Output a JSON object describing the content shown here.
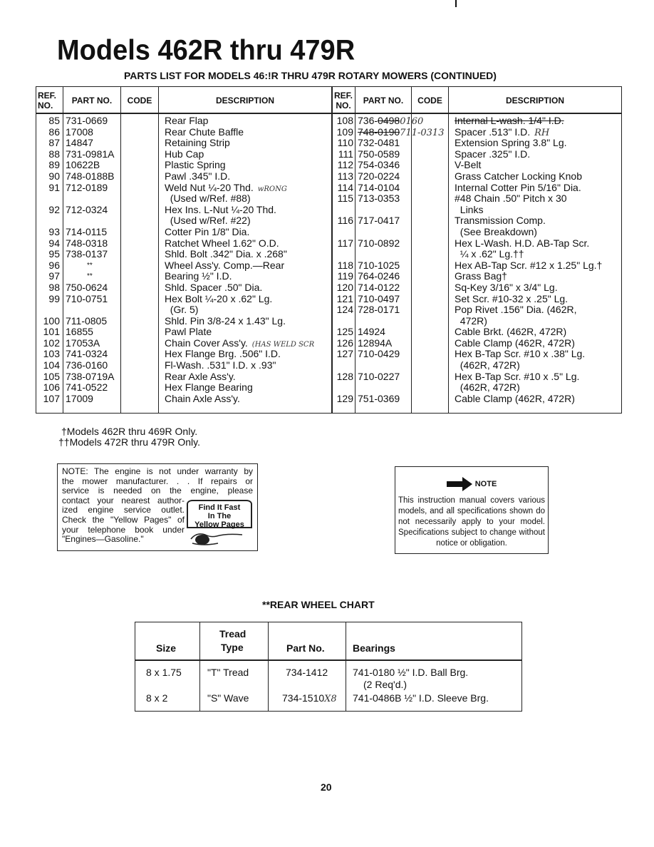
{
  "page": {
    "title": "Models 462R thru 479R",
    "subtitle": "PARTS LIST FOR MODELS 46:!R THRU 479R ROTARY MOWERS (CONTINUED)",
    "page_number": "20"
  },
  "parts_table": {
    "headers": {
      "ref": "REF. NO.",
      "part": "PART NO.",
      "code": "CODE",
      "description": "DESCRIPTION"
    },
    "left_rows": [
      {
        "ref": "85",
        "part": "731-0669",
        "desc": "Rear Flap"
      },
      {
        "ref": "86",
        "part": "17008",
        "desc": "Rear Chute Baffle"
      },
      {
        "ref": "87",
        "part": "14847",
        "desc": "Retaining Strip"
      },
      {
        "ref": "88",
        "part": "731-0981A",
        "desc": "Hub Cap"
      },
      {
        "ref": "89",
        "part": "10622B",
        "desc": "Plastic Spring"
      },
      {
        "ref": "90",
        "part": "748-0188B",
        "desc": "Pawl .345\" I.D."
      },
      {
        "ref": "91",
        "part": "712-0189",
        "desc": "Weld Nut ¼-20 Thd.",
        "annotation": "wRONG"
      },
      {
        "ref": "",
        "part": "",
        "desc": "  (Used w/Ref. #88)"
      },
      {
        "ref": "92",
        "part": "712-0324",
        "desc": "Hex Ins. L-Nut ¼-20 Thd."
      },
      {
        "ref": "",
        "part": "",
        "desc": "  (Used w/Ref. #22)"
      },
      {
        "ref": "93",
        "part": "714-0115",
        "desc": "Cotter Pin 1/8\" Dia."
      },
      {
        "ref": "94",
        "part": "748-0318",
        "desc": "Ratchet Wheel 1.62\" O.D."
      },
      {
        "ref": "95",
        "part": "738-0137",
        "desc": "Shld. Bolt .342\" Dia. x .268\""
      },
      {
        "ref": "96",
        "part": "**",
        "desc": "Wheel Ass'y. Comp.—Rear"
      },
      {
        "ref": "97",
        "part": "**",
        "desc": "Bearing ½\" I.D."
      },
      {
        "ref": "98",
        "part": "750-0624",
        "desc": "Shld. Spacer .50\" Dia."
      },
      {
        "ref": "99",
        "part": "710-0751",
        "desc": "Hex Bolt ¼-20 x .62\" Lg."
      },
      {
        "ref": "",
        "part": "",
        "desc": "  (Gr. 5)"
      },
      {
        "ref": "100",
        "part": "711-0805",
        "desc": "Shld. Pin 3/8-24 x 1.43\" Lg."
      },
      {
        "ref": "101",
        "part": "16855",
        "desc": "Pawl Plate"
      },
      {
        "ref": "102",
        "part": "17053A",
        "desc": "Chain Cover Ass'y.",
        "annotation": "(HAS WELD SCR"
      },
      {
        "ref": "103",
        "part": "741-0324",
        "desc": "Hex Flange Brg. .506\" I.D."
      },
      {
        "ref": "104",
        "part": "736-0160",
        "desc": "Fl-Wash. .531\" I.D. x .93\""
      },
      {
        "ref": "105",
        "part": "738-0719A",
        "desc": "Rear Axle Ass'y."
      },
      {
        "ref": "106",
        "part": "741-0522",
        "desc": "Hex Flange Bearing"
      },
      {
        "ref": "107",
        "part": "17009",
        "desc": "Chain Axle Ass'y."
      }
    ],
    "right_rows": [
      {
        "ref": "108",
        "part": "736-0498",
        "part_strike": "0498",
        "part_prefix": "736-",
        "annotation": "0160",
        "desc": "Internal L-wash. 1/4\" I.D.",
        "desc_strike": true
      },
      {
        "ref": "109",
        "part": "748-0190",
        "part_strike_all": true,
        "annotation": "711-0313",
        "desc": "Spacer .513\" I.D.",
        "desc_annotation": "RH"
      },
      {
        "ref": "110",
        "part": "732-0481",
        "desc": "Extension Spring 3.8\" Lg."
      },
      {
        "ref": "111",
        "part": "750-0589",
        "desc": "Spacer .325\" I.D."
      },
      {
        "ref": "112",
        "part": "754-0346",
        "desc": "V-Belt"
      },
      {
        "ref": "113",
        "part": "720-0224",
        "desc": "Grass Catcher Locking Knob"
      },
      {
        "ref": "114",
        "part": "714-0104",
        "desc": "Internal Cotter Pin 5/16\" Dia."
      },
      {
        "ref": "115",
        "part": "713-0353",
        "desc": "#48 Chain .50\" Pitch x 30"
      },
      {
        "ref": "",
        "part": "",
        "desc": "  Links"
      },
      {
        "ref": "116",
        "part": "717-0417",
        "desc": "Transmission Comp."
      },
      {
        "ref": "",
        "part": "",
        "desc": "  (See Breakdown)"
      },
      {
        "ref": "117",
        "part": "710-0892",
        "desc": "Hex L-Wash. H.D. AB-Tap Scr."
      },
      {
        "ref": "",
        "part": "",
        "desc": "  ¼ x .62\" Lg.††"
      },
      {
        "ref": "118",
        "part": "710-1025",
        "desc": "Hex AB-Tap Scr. #12 x 1.25\" Lg.†"
      },
      {
        "ref": "119",
        "part": "764-0246",
        "desc": "Grass Bag†"
      },
      {
        "ref": "120",
        "part": "714-0122",
        "desc": "Sq-Key 3/16\" x 3/4\" Lg."
      },
      {
        "ref": "121",
        "part": "710-0497",
        "desc": "Set Scr. #10-32 x .25\" Lg."
      },
      {
        "ref": "124",
        "part": "728-0171",
        "desc": "Pop Rivet .156\" Dia. (462R,"
      },
      {
        "ref": "",
        "part": "",
        "desc": "  472R)"
      },
      {
        "ref": "125",
        "part": "14924",
        "desc": "Cable Brkt. (462R, 472R)"
      },
      {
        "ref": "126",
        "part": "12894A",
        "desc": "Cable Clamp (462R, 472R)"
      },
      {
        "ref": "127",
        "part": "710-0429",
        "desc": "Hex B-Tap Scr. #10 x .38\" Lg."
      },
      {
        "ref": "",
        "part": "",
        "desc": "  (462R, 472R)"
      },
      {
        "ref": "128",
        "part": "710-0227",
        "desc": "Hex B-Tap Scr. #10 x .5\" Lg."
      },
      {
        "ref": "",
        "part": "",
        "desc": "  (462R, 472R)"
      },
      {
        "ref": "129",
        "part": "751-0369",
        "desc": "Cable Clamp (462R, 472R)"
      }
    ]
  },
  "footnotes": [
    "†Models 462R thru 469R Only.",
    "††Models 472R thru 479R Only."
  ],
  "warranty_note": {
    "lines_full": [
      "NOTE: The engine is not under warranty by",
      "the mower manufacturer. . . If repairs or",
      "service is needed on the engine, please"
    ],
    "lines_narrow": [
      "contact your nearest author-",
      "ized engine service outlet.",
      "Check the \"Yellow Pages\" of",
      "your telephone book under",
      "\"Engines—Gasoline.\""
    ],
    "badge_lines": [
      "Find It Fast",
      "In The",
      "Yellow Pages"
    ]
  },
  "info_note": {
    "heading": "NOTE",
    "icon": "arrow-right-icon",
    "text": "This instruction manual covers various models, and all specifications shown do not necessarily apply to your model. Specifications subject to change without notice or obligation."
  },
  "rear_wheel_chart": {
    "title": "**REAR WHEEL CHART",
    "headers": {
      "size": "Size",
      "tread_line1": "Tread",
      "tread_line2": "Type",
      "part": "Part No.",
      "bearings": "Bearings"
    },
    "rows": [
      {
        "size": "8 x 1.75",
        "tread": "\"T\" Tread",
        "part": "734-1412",
        "bearings": "741-0180 ½\" I.D. Ball Brg.",
        "bearings_2": "(2 Req'd.)"
      },
      {
        "size": "8 x 2",
        "tread": "\"S\" Wave",
        "part": "734-1510",
        "part_annotation": "X8",
        "bearings": "741-0486B ½\" I.D. Sleeve Brg."
      }
    ]
  }
}
